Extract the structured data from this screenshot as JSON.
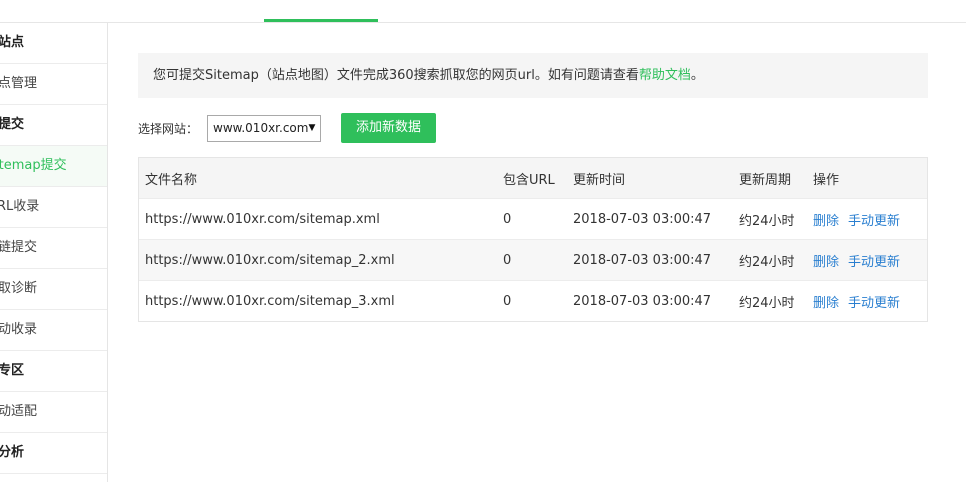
{
  "sidebar": {
    "items": [
      {
        "label": "站点",
        "type": "group"
      },
      {
        "label": "点管理",
        "type": "sub"
      },
      {
        "label": "提交",
        "type": "group"
      },
      {
        "label": "itemap提交",
        "type": "active"
      },
      {
        "label": "RL收录",
        "type": "sub"
      },
      {
        "label": "链提交",
        "type": "sub"
      },
      {
        "label": "取诊断",
        "type": "sub"
      },
      {
        "label": "动收录",
        "type": "sub"
      },
      {
        "label": "专区",
        "type": "group"
      },
      {
        "label": "动适配",
        "type": "sub"
      },
      {
        "label": "分析",
        "type": "group"
      }
    ]
  },
  "notice": {
    "text": "您可提交Sitemap（站点地图）文件完成360搜索抓取您的网页url。如有问题请查看",
    "link": "帮助文档",
    "end": "。"
  },
  "site_select": {
    "label": "选择网站：",
    "value": "www.010xr.com",
    "arrow": "▼"
  },
  "add_button": "添加新数据",
  "table": {
    "headers": [
      "文件名称",
      "包含URL",
      "更新时间",
      "更新周期",
      "操作"
    ],
    "rows": [
      {
        "file": "https://www.010xr.com/sitemap.xml",
        "urls": "0",
        "time": "2018-07-03 03:00:47",
        "period": "约24小时",
        "delete": "删除",
        "update": "手动更新"
      },
      {
        "file": "https://www.010xr.com/sitemap_2.xml",
        "urls": "0",
        "time": "2018-07-03 03:00:47",
        "period": "约24小时",
        "delete": "删除",
        "update": "手动更新"
      },
      {
        "file": "https://www.010xr.com/sitemap_3.xml",
        "urls": "0",
        "time": "2018-07-03 03:00:47",
        "period": "约24小时",
        "delete": "删除",
        "update": "手动更新"
      }
    ]
  },
  "colors": {
    "accent": "#2fbf5b",
    "link": "#2a7fd0"
  }
}
